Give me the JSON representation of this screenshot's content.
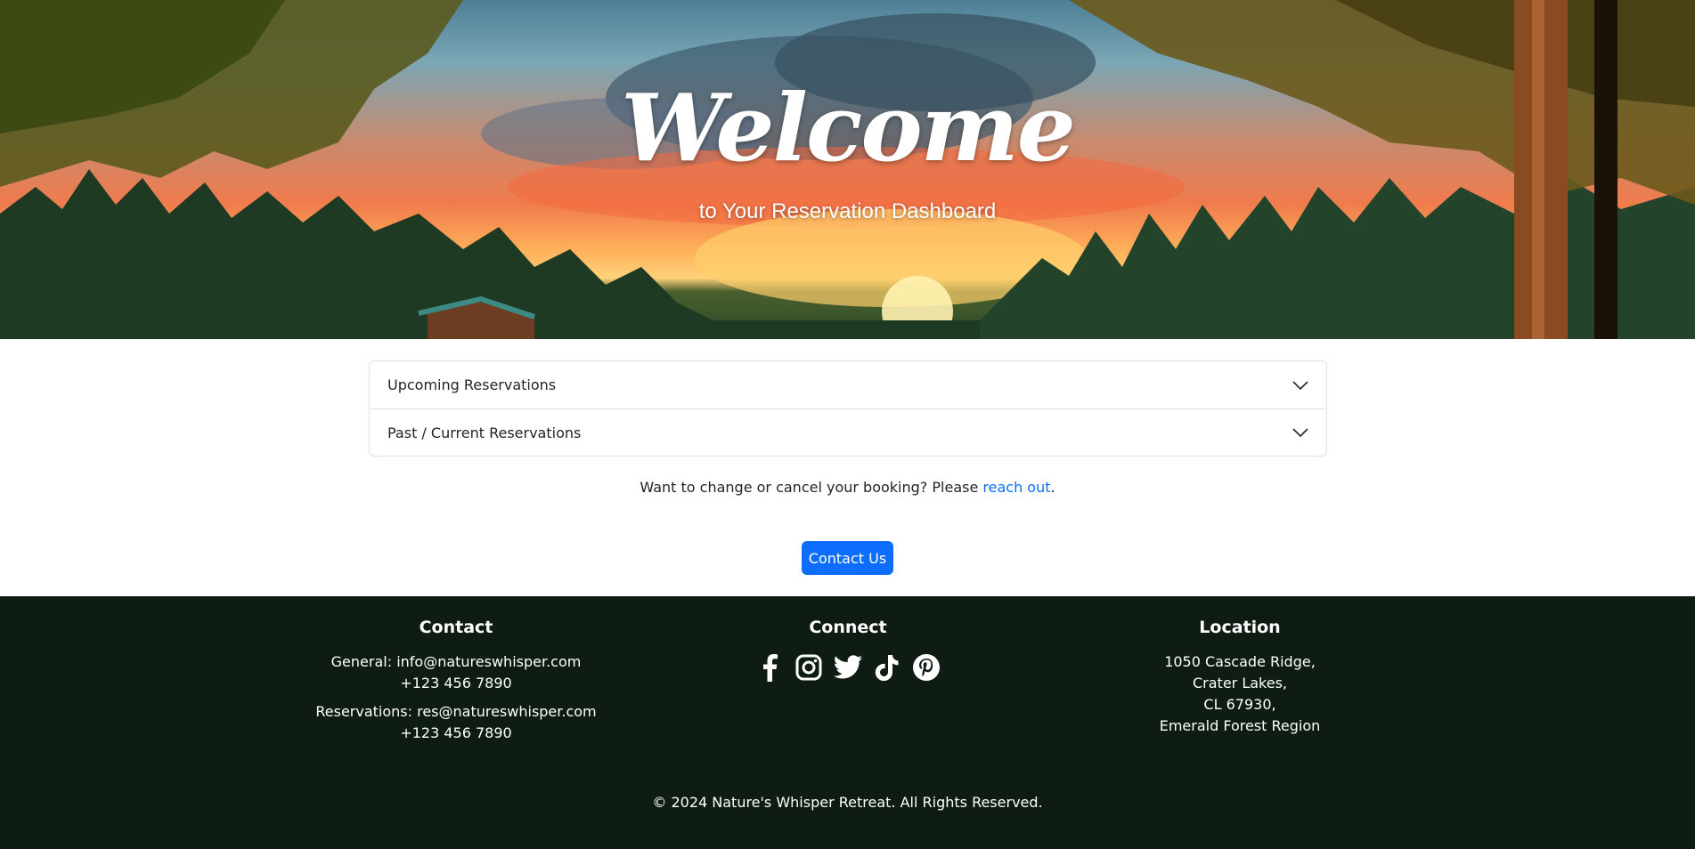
{
  "hero": {
    "title": "Welcome",
    "subtitle": "to Your Reservation Dashboard"
  },
  "accordion": {
    "items": [
      {
        "label": "Upcoming Reservations",
        "icon": "chevron-down-icon"
      },
      {
        "label": "Past / Current Reservations",
        "icon": "chevron-down-icon"
      }
    ]
  },
  "booking_note": {
    "text": "Want to change or cancel your booking? Please ",
    "link": "reach out",
    "end": "."
  },
  "contact_button": {
    "label": "Contact Us"
  },
  "footer": {
    "contact": {
      "heading": "Contact",
      "general_label": "General: info@natureswhisper.com",
      "general_phone": "+123 456 7890",
      "reservations_label": "Reservations: res@natureswhisper.com",
      "reservations_phone": "+123 456 7890"
    },
    "connect": {
      "heading": "Connect",
      "icons": [
        "facebook-icon",
        "instagram-icon",
        "twitter-icon",
        "tiktok-icon",
        "pinterest-icon"
      ]
    },
    "location": {
      "heading": "Location",
      "line1": "1050 Cascade Ridge,",
      "line2": "Crater Lakes,",
      "line3": "CL 67930,",
      "line4": "Emerald Forest Region"
    },
    "copyright": "© 2024 Nature's Whisper Retreat. All Rights Reserved."
  },
  "colors": {
    "accent": "#0d6efd",
    "footer_bg": "#0e1c12"
  }
}
